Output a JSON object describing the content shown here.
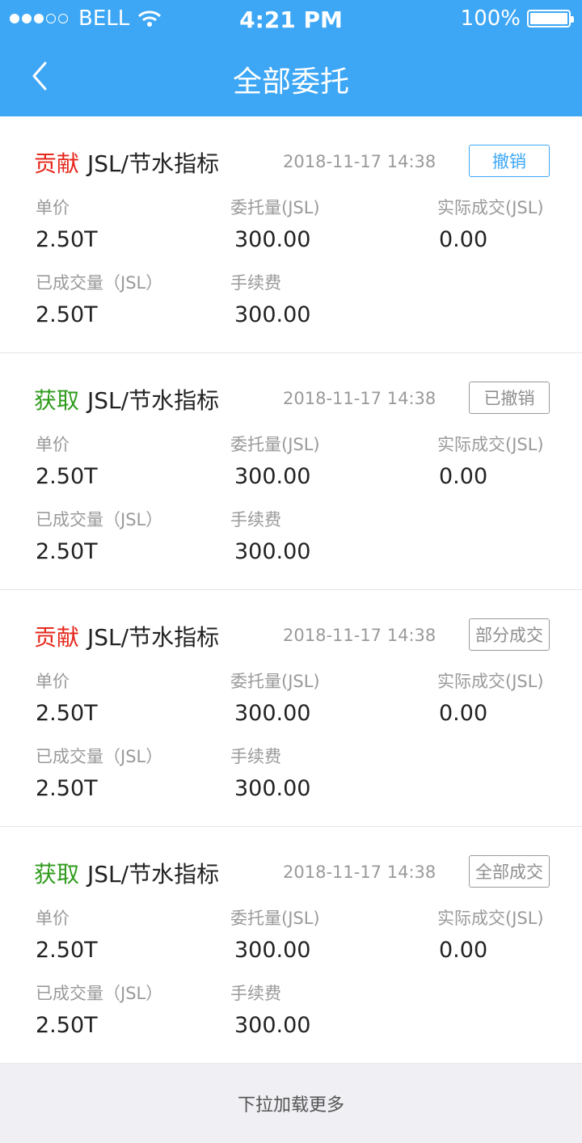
{
  "status_bar": {
    "carrier": "BELL",
    "time": "4:21 PM",
    "battery": "100%",
    "signal_filled": 3,
    "signal_total": 5
  },
  "nav": {
    "title": "全部委托"
  },
  "labels": {
    "price": "单价",
    "order_qty": "委托量(JSL)",
    "actual_deal": "实际成交(JSL)",
    "filled_qty": "已成交量（JSL）",
    "fee": "手续费"
  },
  "orders": [
    {
      "type": "贡献",
      "type_kind": "contribute",
      "pair": "JSL/节水指标",
      "time": "2018-11-17 14:38",
      "status": "撤销",
      "status_active": true,
      "price": "2.50T",
      "order_qty": "300.00",
      "actual_deal": "0.00",
      "filled_qty": "2.50T",
      "fee": "300.00"
    },
    {
      "type": "获取",
      "type_kind": "acquire",
      "pair": "JSL/节水指标",
      "time": "2018-11-17 14:38",
      "status": "已撤销",
      "status_active": false,
      "price": "2.50T",
      "order_qty": "300.00",
      "actual_deal": "0.00",
      "filled_qty": "2.50T",
      "fee": "300.00"
    },
    {
      "type": "贡献",
      "type_kind": "contribute",
      "pair": "JSL/节水指标",
      "time": "2018-11-17 14:38",
      "status": "部分成交",
      "status_active": false,
      "price": "2.50T",
      "order_qty": "300.00",
      "actual_deal": "0.00",
      "filled_qty": "2.50T",
      "fee": "300.00"
    },
    {
      "type": "获取",
      "type_kind": "acquire",
      "pair": "JSL/节水指标",
      "time": "2018-11-17 14:38",
      "status": "全部成交",
      "status_active": false,
      "price": "2.50T",
      "order_qty": "300.00",
      "actual_deal": "0.00",
      "filled_qty": "2.50T",
      "fee": "300.00"
    }
  ],
  "footer": {
    "text": "下拉加载更多"
  },
  "colors": {
    "header": "#3da7f5",
    "contribute": "#e6271b",
    "acquire": "#2f9b1c"
  }
}
